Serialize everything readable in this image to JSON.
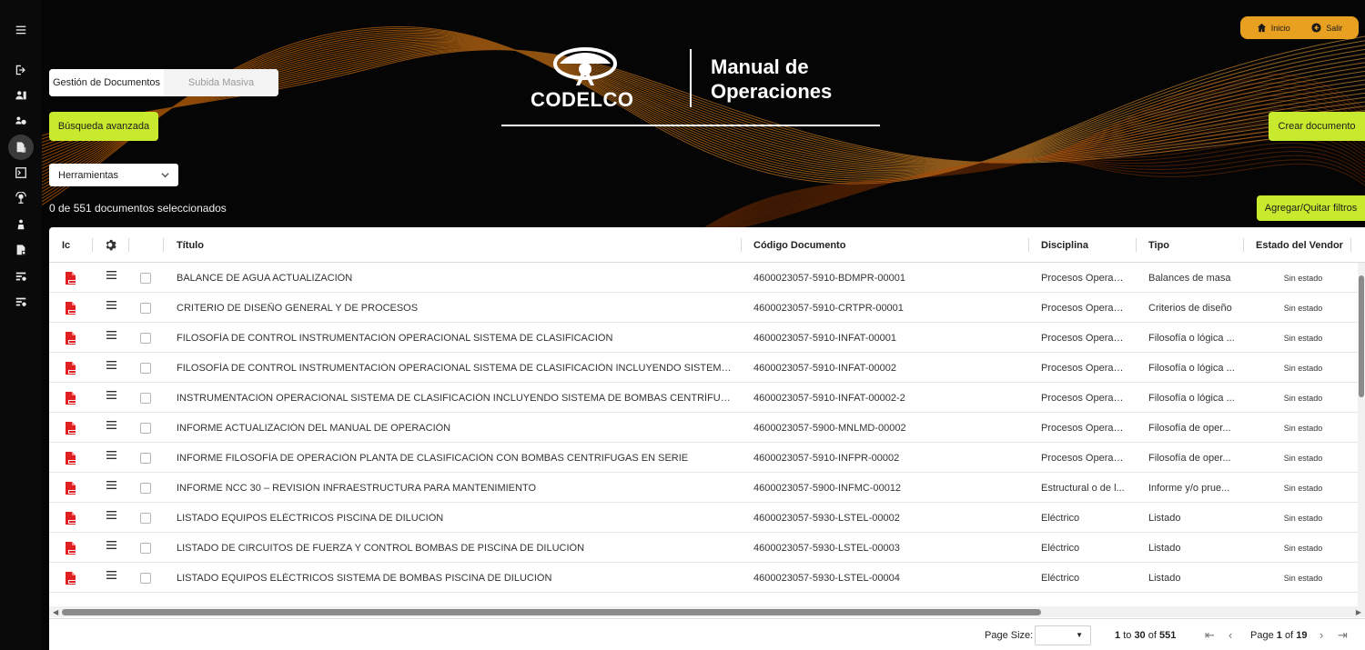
{
  "header": {
    "brand": "CODELCO",
    "title_line1": "Manual de",
    "title_line2": "Operaciones",
    "inicio_label": "Inicio",
    "salir_label": "Salir"
  },
  "tabs": [
    {
      "label": "Gestión de Documentos",
      "active": true
    },
    {
      "label": "Subida Masiva",
      "active": false
    }
  ],
  "actions": {
    "advanced_search": "Búsqueda avanzada",
    "create_document": "Crear documento",
    "toggle_filters": "Agregar/Quitar filtros",
    "tools_select": "Herramientas"
  },
  "selection_status": "0 de 551 documentos seleccionados",
  "rail_icons": [
    "menu-icon",
    "logout-icon",
    "users-icon",
    "org-icon",
    "documents-icon",
    "console-icon",
    "network-icon",
    "person-icon",
    "reports-icon",
    "settings-list-icon",
    "settings-list-2-icon"
  ],
  "grid": {
    "columns": {
      "icon": "Ic",
      "title": "Título",
      "code": "Código Documento",
      "discipline": "Disciplina",
      "type": "Tipo",
      "vendor_state": "Estado del Vendor"
    },
    "rows": [
      {
        "title": "BALANCE DE AGUA ACTUALIZACIÓN",
        "code": "4600023057-5910-BDMPR-00001",
        "discipline": "Procesos Operaci...",
        "type": "Balances de masa",
        "state": "Sin estado"
      },
      {
        "title": "CRITERIO DE DISEÑO GENERAL Y DE PROCESOS",
        "code": "4600023057-5910-CRTPR-00001",
        "discipline": "Procesos Operaci...",
        "type": "Criterios de diseño",
        "state": "Sin estado"
      },
      {
        "title": "FILOSOFÍA DE CONTROL INSTRUMENTACIÓN OPERACIONAL SISTEMA DE CLASIFICACIÓN",
        "code": "4600023057-5910-INFAT-00001",
        "discipline": "Procesos Operaci...",
        "type": "Filosofía o lógica ...",
        "state": "Sin estado"
      },
      {
        "title": "FILOSOFÍA DE CONTROL INSTRUMENTACIÓN OPERACIONAL SISTEMA DE CLASIFICACIÓN INCLUYENDO SISTEMA DE BOMBAS",
        "code": "4600023057-5910-INFAT-00002",
        "discipline": "Procesos Operaci...",
        "type": "Filosofía o lógica ...",
        "state": "Sin estado"
      },
      {
        "title": "INSTRUMENTACIÓN OPERACIONAL SISTEMA DE CLASIFICACIÓN INCLUYENDO SISTEMA DE BOMBAS CENTRÍFUGAS EN SERIE",
        "code": "4600023057-5910-INFAT-00002-2",
        "discipline": "Procesos Operaci...",
        "type": "Filosofía o lógica ...",
        "state": "Sin estado"
      },
      {
        "title": "INFORME ACTUALIZACIÓN DEL MANUAL DE OPERACIÓN",
        "code": "4600023057-5900-MNLMD-00002",
        "discipline": "Procesos Operaci...",
        "type": "Filosofía de oper...",
        "state": "Sin estado"
      },
      {
        "title": "INFORME FILOSOFÍA DE OPERACIÓN PLANTA DE CLASIFICACIÓN CON BOMBAS CENTRIFUGAS EN SERIE",
        "code": "4600023057-5910-INFPR-00002",
        "discipline": "Procesos Operaci...",
        "type": "Filosofía de oper...",
        "state": "Sin estado"
      },
      {
        "title": "INFORME NCC 30 – REVISIÓN INFRAESTRUCTURA PARA MANTENIMIENTO",
        "code": "4600023057-5900-INFMC-00012",
        "discipline": "Estructural o de l...",
        "type": "Informe y/o prue...",
        "state": "Sin estado"
      },
      {
        "title": "LISTADO EQUIPOS ELÉCTRICOS PISCINA DE DILUCIÓN",
        "code": "4600023057-5930-LSTEL-00002",
        "discipline": "Eléctrico",
        "type": "Listado",
        "state": "Sin estado"
      },
      {
        "title": "LISTADO DE CIRCUITOS DE FUERZA Y CONTROL BOMBAS DE PISCINA DE DILUCIÓN",
        "code": "4600023057-5930-LSTEL-00003",
        "discipline": "Eléctrico",
        "type": "Listado",
        "state": "Sin estado"
      },
      {
        "title": "LISTADO EQUIPOS ELÉCTRICOS SISTEMA DE BOMBAS PISCINA DE DILUCIÓN",
        "code": "4600023057-5930-LSTEL-00004",
        "discipline": "Eléctrico",
        "type": "Listado",
        "state": "Sin estado"
      }
    ]
  },
  "pager": {
    "page_size_label": "Page Size:",
    "range_from": "1",
    "range_to_word": "to",
    "range_to": "30",
    "of_word": "of",
    "total": "551",
    "page_word": "Page",
    "page_current": "1",
    "page_total": "19"
  },
  "colors": {
    "accent_lime": "#c8ea2e",
    "accent_orange": "#e8a020",
    "pdf_red": "#e02020"
  }
}
